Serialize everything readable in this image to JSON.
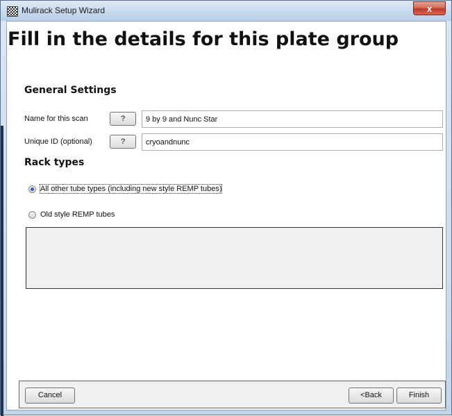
{
  "window": {
    "title": "Mulirack Setup Wizard",
    "close_label": "x"
  },
  "page": {
    "title": "Fill in the details for this plate group"
  },
  "general_settings": {
    "heading": "General Settings",
    "name_field": {
      "label": "Name for this scan",
      "help_label": "?",
      "value": "9 by 9 and Nunc Star"
    },
    "id_field": {
      "label": "Unique ID (optional)",
      "help_label": "?",
      "value": "cryoandnunc"
    }
  },
  "rack_types": {
    "heading": "Rack types",
    "options": [
      {
        "label": "All other tube types (including new style REMP tubes)",
        "selected": true
      },
      {
        "label": "Old style REMP tubes",
        "selected": false
      }
    ]
  },
  "footer": {
    "cancel_label": "Cancel",
    "back_label": "<Back",
    "finish_label": "Finish"
  }
}
